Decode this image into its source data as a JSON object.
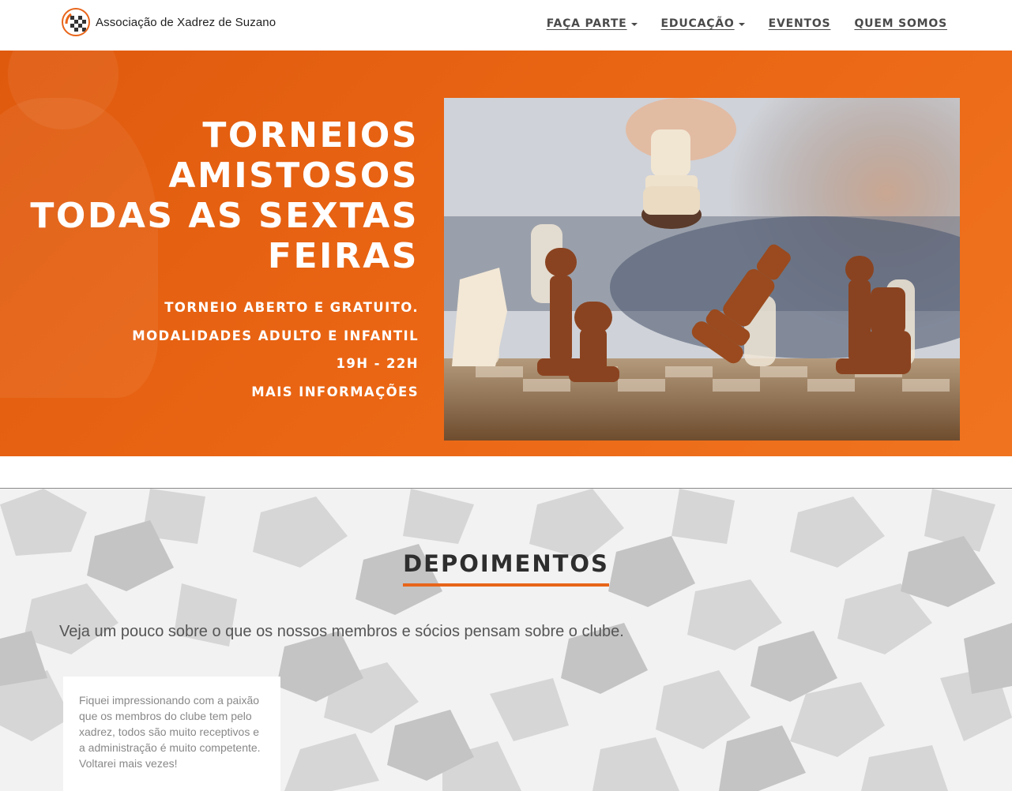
{
  "header": {
    "brand": "Associação de Xadrez de Suzano",
    "nav": [
      {
        "label": "FAÇA PARTE",
        "dropdown": true
      },
      {
        "label": "EDUCAÇÃO",
        "dropdown": true
      },
      {
        "label": "EVENTOS",
        "dropdown": false
      },
      {
        "label": "QUEM SOMOS",
        "dropdown": false
      }
    ]
  },
  "hero": {
    "title_lines": [
      "TORNEIOS",
      "AMISTOSOS",
      "TODAS AS SEXTAS",
      "FEIRAS"
    ],
    "details": [
      "TORNEIO ABERTO E GRATUITO.",
      "MODALIDADES ADULTO E INFANTIL",
      "19H - 22H"
    ],
    "more_info": "MAIS INFORMAÇÕES",
    "accent_color": "#e8651a"
  },
  "testimonials": {
    "title": "DEPOIMENTOS",
    "subtitle": "Veja um pouco sobre o que os nossos membros e sócios pensam sobre o clube.",
    "cards": [
      {
        "text": "Fiquei impressionando com a paixão que os membros do clube tem pelo xadrez, todos são muito receptivos e a administração é muito competente. Voltarei mais vezes!"
      }
    ]
  }
}
